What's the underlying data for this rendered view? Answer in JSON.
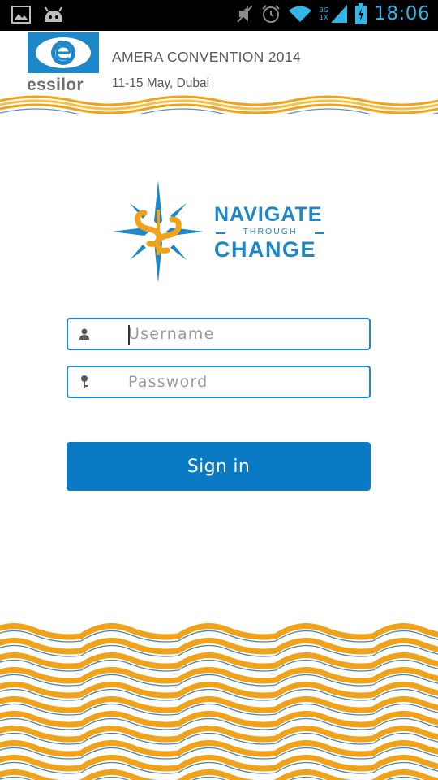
{
  "status_bar": {
    "time": "18:06",
    "network_top": "3G",
    "network_bottom": "1X",
    "icons": [
      "image-icon",
      "android-icon",
      "mute-icon",
      "alarm-icon",
      "wifi-icon",
      "signal-icon",
      "battery-icon"
    ]
  },
  "header": {
    "brand": "essilor",
    "title": "AMERA CONVENTION 2014",
    "subtitle": "11-15 May, Dubai"
  },
  "logo": {
    "line1": "NAVIGATE",
    "line2": "THROUGH",
    "line3": "CHANGE"
  },
  "form": {
    "username_placeholder": "Username",
    "password_placeholder": "Password",
    "username_icon": "person-icon",
    "password_icon": "key-icon"
  },
  "signin_label": "Sign in",
  "colors": {
    "brand_blue": "#1d87c8",
    "button_blue": "#0a7ac5",
    "wave_orange": "#f0a21a",
    "status_blue": "#33b5e5"
  }
}
